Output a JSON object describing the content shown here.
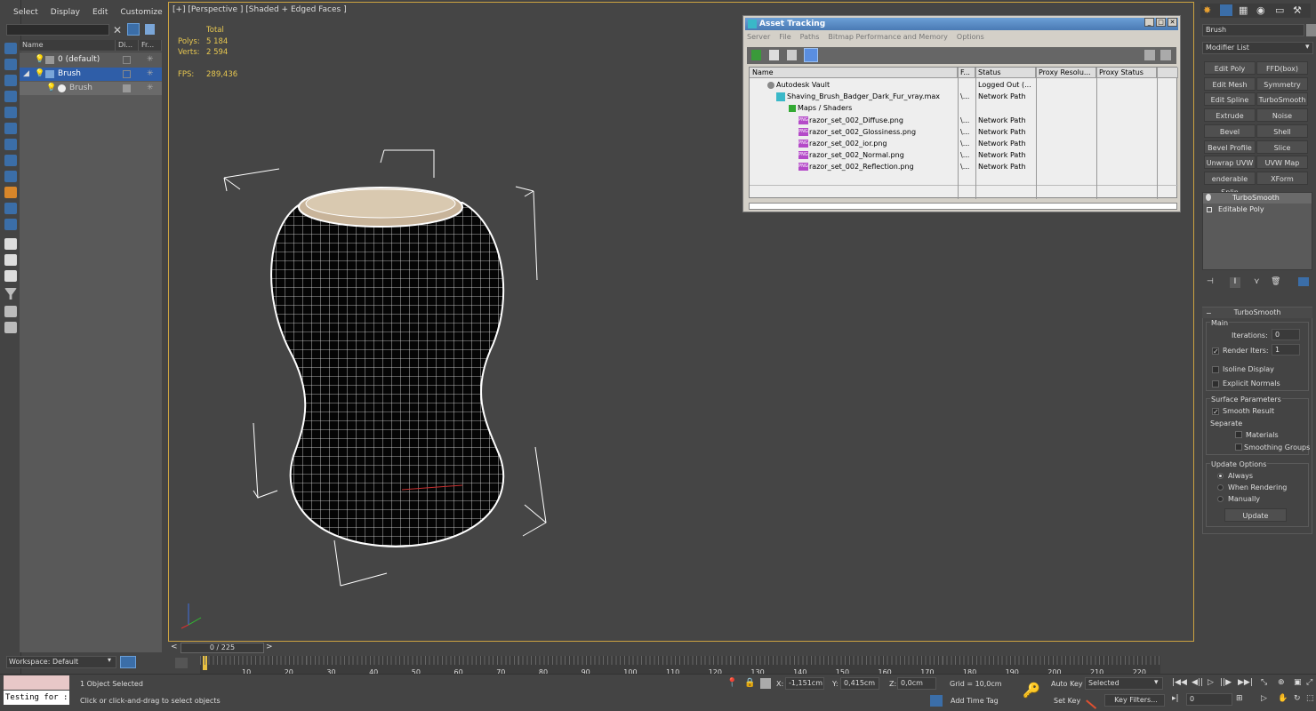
{
  "menubar": {
    "items": [
      "Select",
      "Display",
      "Edit",
      "Customize"
    ]
  },
  "explorer": {
    "columns": [
      "Name",
      "Di...",
      "Fr..."
    ],
    "rows": [
      {
        "label": "0 (default)"
      },
      {
        "label": "Brush"
      },
      {
        "label": "Brush"
      }
    ],
    "workspace": "Workspace: Default"
  },
  "viewport": {
    "label": "[+] [Perspective ] [Shaded + Edged Faces ]",
    "stats": {
      "total_label": "Total",
      "polys_label": "Polys:",
      "polys": "5 184",
      "verts_label": "Verts:",
      "verts": "2 594",
      "fps_label": "FPS:",
      "fps": "289,436"
    }
  },
  "asset_tracking": {
    "title": "Asset Tracking",
    "menu": [
      "Server",
      "File",
      "Paths",
      "Bitmap Performance and Memory",
      "Options"
    ],
    "columns": [
      "Name",
      "F...",
      "Status",
      "Proxy Resolu...",
      "Proxy Status"
    ],
    "rows": [
      {
        "name": "Autodesk Vault",
        "f": "",
        "status": "Logged Out (...",
        "type": "vault"
      },
      {
        "name": "Shaving_Brush_Badger_Dark_Fur_vray.max",
        "f": "\\...",
        "status": "Network Path",
        "type": "max"
      },
      {
        "name": "Maps / Shaders",
        "f": "",
        "status": "",
        "type": "maps"
      },
      {
        "name": "razor_set_002_Diffuse.png",
        "f": "\\...",
        "status": "Network Path",
        "type": "png"
      },
      {
        "name": "razor_set_002_Glossiness.png",
        "f": "\\...",
        "status": "Network Path",
        "type": "png"
      },
      {
        "name": "razor_set_002_ior.png",
        "f": "\\...",
        "status": "Network Path",
        "type": "png"
      },
      {
        "name": "razor_set_002_Normal.png",
        "f": "\\...",
        "status": "Network Path",
        "type": "png"
      },
      {
        "name": "razor_set_002_Reflection.png",
        "f": "\\...",
        "status": "Network Path",
        "type": "png"
      }
    ],
    "png_badge": "PNG"
  },
  "command_panel": {
    "object_name": "Brush",
    "modifier_list": "Modifier List",
    "modifier_buttons": [
      "Edit Poly",
      "FFD(box)",
      "Edit Mesh",
      "Symmetry",
      "Edit Spline",
      "TurboSmooth",
      "Extrude",
      "Noise",
      "Bevel",
      "Shell",
      "Bevel Profile",
      "Slice",
      "Unwrap UVW",
      "UVW Map",
      "enderable Splin",
      "XForm"
    ],
    "stack": [
      "TurboSmooth",
      "Editable Poly"
    ],
    "rollout_title": "TurboSmooth",
    "main_label": "Main",
    "iterations_label": "Iterations:",
    "iterations": "0",
    "render_iters_label": "Render Iters:",
    "render_iters": "1",
    "isoline_label": "Isoline Display",
    "explicit_label": "Explicit Normals",
    "surface_label": "Surface Parameters",
    "smooth_label": "Smooth Result",
    "separate_label": "Separate",
    "materials_label": "Materials",
    "smoothing_label": "Smoothing Groups",
    "update_options_label": "Update Options",
    "always_label": "Always",
    "when_rendering_label": "When Rendering",
    "manually_label": "Manually",
    "update_button": "Update"
  },
  "timeline": {
    "slider": "0 / 225",
    "ticks": [
      "10",
      "20",
      "30",
      "40",
      "50",
      "60",
      "70",
      "80",
      "90",
      "100",
      "110",
      "120",
      "130",
      "140",
      "150",
      "160",
      "170",
      "180",
      "190",
      "200",
      "210",
      "220"
    ]
  },
  "status": {
    "maxscript": "Testing for :",
    "selected": "1 Object Selected",
    "prompt": "Click or click-and-drag to select objects",
    "x_label": "X:",
    "x": "-1,151cm",
    "y_label": "Y:",
    "y": "0,415cm",
    "z_label": "Z:",
    "z": "0,0cm",
    "grid": "Grid = 10,0cm",
    "add_time_tag": "Add Time Tag",
    "auto_key": "Auto Key",
    "selected_dropdown": "Selected",
    "set_key": "Set Key",
    "key_filters": "Key Filters...",
    "frame": "0"
  }
}
